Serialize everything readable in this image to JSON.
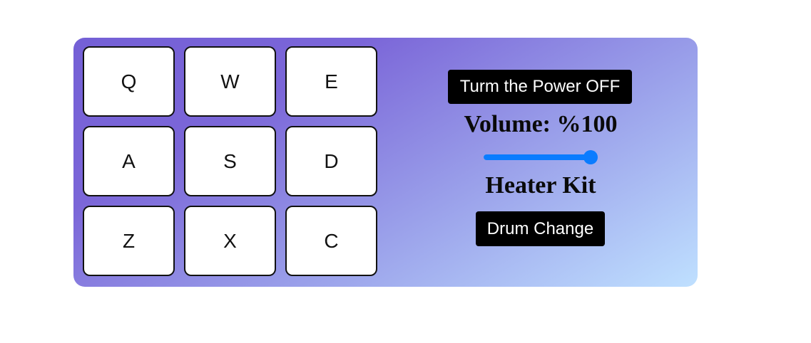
{
  "pads": [
    {
      "key": "Q"
    },
    {
      "key": "W"
    },
    {
      "key": "E"
    },
    {
      "key": "A"
    },
    {
      "key": "S"
    },
    {
      "key": "D"
    },
    {
      "key": "Z"
    },
    {
      "key": "X"
    },
    {
      "key": "C"
    }
  ],
  "controls": {
    "power_button_label": "Turm the Power OFF",
    "volume_text": "Volume: %100",
    "volume_value": 1.0,
    "kit_name": "Heater Kit",
    "drum_change_label": "Drum Change"
  },
  "colors": {
    "accent": "#0a7cff",
    "gradient_start": "#7460d6",
    "gradient_end": "#bfe0ff",
    "button_bg": "#000000"
  }
}
